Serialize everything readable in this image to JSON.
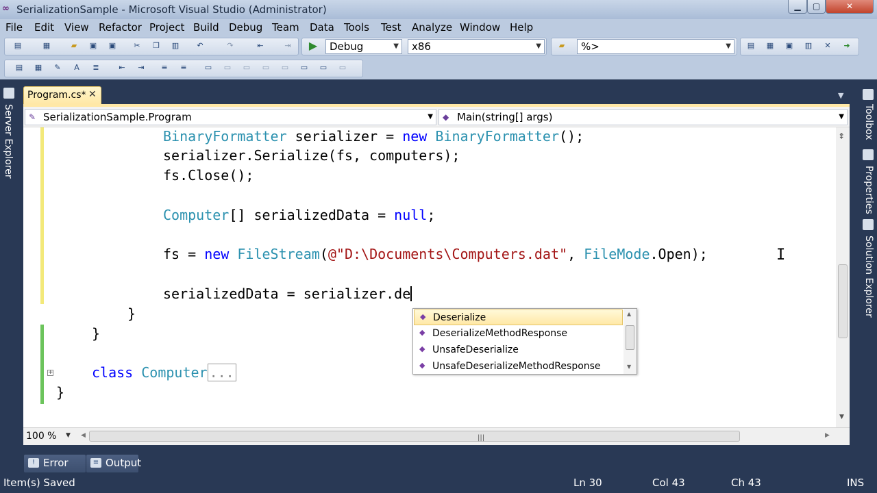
{
  "window": {
    "title": "SerializationSample - Microsoft Visual Studio (Administrator)",
    "app_icon": "visual-studio-icon",
    "minimize": "▁",
    "maximize": "▢",
    "close": "✕"
  },
  "menu": [
    "File",
    "Edit",
    "View",
    "Refactor",
    "Project",
    "Build",
    "Debug",
    "Team",
    "Data",
    "Tools",
    "Test",
    "Analyze",
    "Window",
    "Help"
  ],
  "toolbar": {
    "configuration": "Debug",
    "platform": "x86",
    "find_box": "%>"
  },
  "side_panels": {
    "left": "Server Explorer",
    "right": [
      "Toolbox",
      "Properties",
      "Solution Explorer"
    ]
  },
  "document_tab": {
    "label": "Program.cs*",
    "close": "✕"
  },
  "navigation": {
    "type_dropdown": "SerializationSample.Program",
    "member_dropdown": "Main(string[] args)"
  },
  "code": {
    "line1": {
      "t1": "BinaryFormatter",
      "t2": " serializer = ",
      "t3": "new",
      "t4": " ",
      "t5": "BinaryFormatter",
      "t6": "();"
    },
    "line2": "serializer.Serialize(fs, computers);",
    "line3": "fs.Close();",
    "line4": {
      "t1": "Computer",
      "t2": "[] serializedData = ",
      "t3": "null",
      "t4": ";"
    },
    "line5": {
      "t1": "fs = ",
      "t2": "new",
      "t3": " ",
      "t4": "FileStream",
      "t5": "(",
      "t6": "@\"D:\\Documents\\Computers.dat\"",
      "t7": ", ",
      "t8": "FileMode",
      "t9": ".Open);"
    },
    "line6": "serializedData = serializer.de",
    "line7": "}",
    "line8": "}",
    "line9": {
      "t1": "class",
      "t2": " ",
      "t3": "Computer",
      "t4": "..."
    },
    "line10": "}"
  },
  "intellisense": {
    "items": [
      "Deserialize",
      "DeserializeMethodResponse",
      "UnsafeDeserialize",
      "UnsafeDeserializeMethodResponse"
    ],
    "selected": "Deserialize"
  },
  "editor_footer": {
    "zoom": "100 %"
  },
  "tool_windows": [
    "Error List",
    "Output"
  ],
  "status": {
    "message": "Item(s) Saved",
    "line": "Ln 30",
    "col": "Col 43",
    "ch": "Ch 43",
    "mode": "INS"
  },
  "colors": {
    "chrome": "#293955",
    "keyword": "#0000ff",
    "type": "#2b91af",
    "string": "#a31515",
    "selection": "#ffe8a6"
  }
}
